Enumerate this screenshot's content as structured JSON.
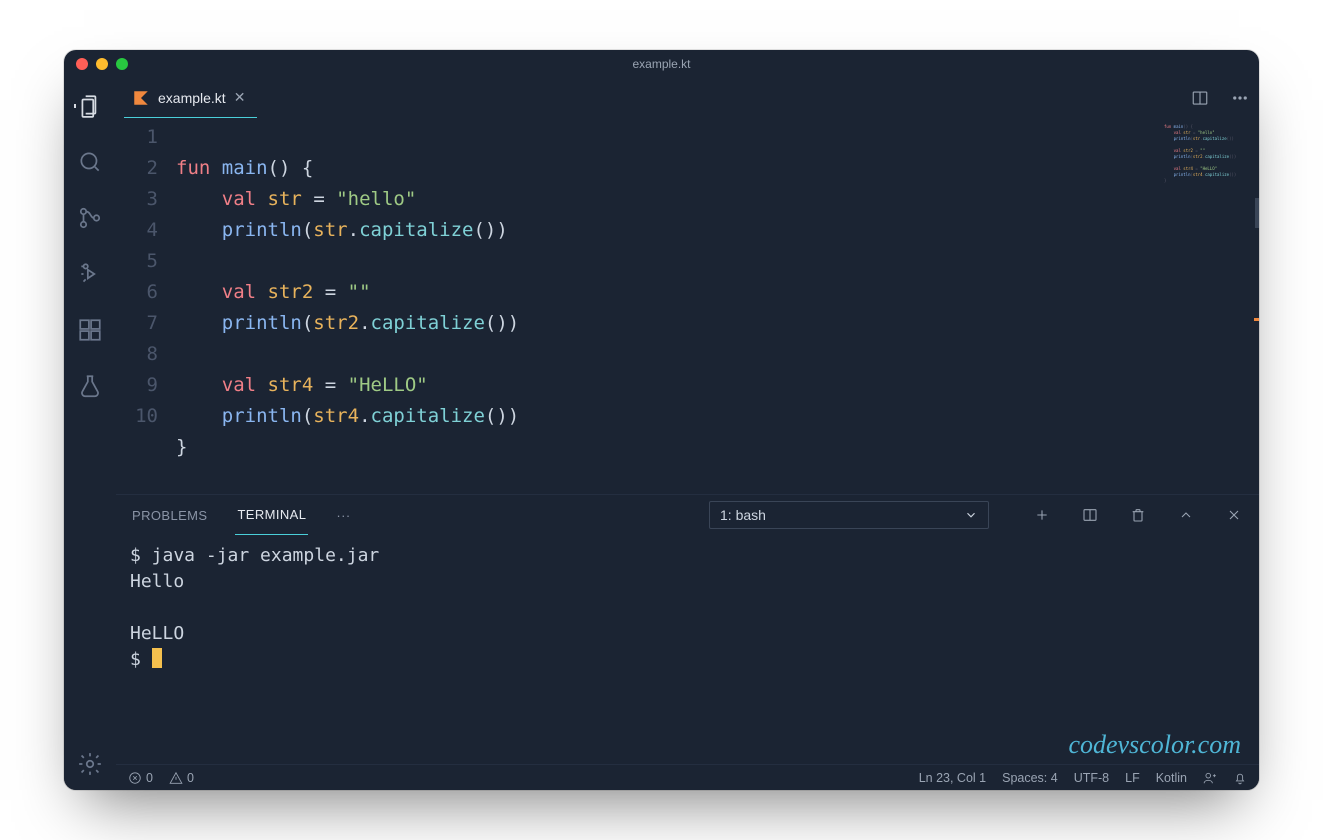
{
  "window": {
    "title": "example.kt"
  },
  "tab": {
    "name": "example.kt"
  },
  "code": {
    "lines": [
      "1",
      "2",
      "3",
      "4",
      "5",
      "6",
      "7",
      "8",
      "9",
      "10"
    ],
    "l1": {
      "kw": "fun",
      "fn": "main",
      "a": "() {"
    },
    "l2": {
      "kw": "val",
      "var": "str",
      "eq": " = ",
      "str": "\"hello\""
    },
    "l3": {
      "fn": "println",
      "a": "(",
      "var": "str",
      "dot": ".",
      "call": "capitalize",
      "b": "())"
    },
    "l5": {
      "kw": "val",
      "var": "str2",
      "eq": " = ",
      "str": "\"\""
    },
    "l6": {
      "fn": "println",
      "a": "(",
      "var": "str2",
      "dot": ".",
      "call": "capitalize",
      "b": "())"
    },
    "l8": {
      "kw": "val",
      "var": "str4",
      "eq": " = ",
      "str": "\"HeLLO\""
    },
    "l9": {
      "fn": "println",
      "a": "(",
      "var": "str4",
      "dot": ".",
      "call": "capitalize",
      "b": "())"
    },
    "l10": {
      "brace": "}"
    }
  },
  "panel": {
    "tabs": {
      "problems": "PROBLEMS",
      "terminal": "TERMINAL",
      "more": "···"
    },
    "terminalSelector": "1: bash"
  },
  "terminal": {
    "line1": "$ java -jar example.jar",
    "line2": "Hello",
    "line3": "",
    "line4": "HeLLO",
    "prompt": "$ "
  },
  "watermark": "codevscolor.com",
  "status": {
    "errors": "0",
    "warnings": "0",
    "pos": "Ln 23, Col 1",
    "spaces": "Spaces: 4",
    "encoding": "UTF-8",
    "eol": "LF",
    "lang": "Kotlin"
  }
}
